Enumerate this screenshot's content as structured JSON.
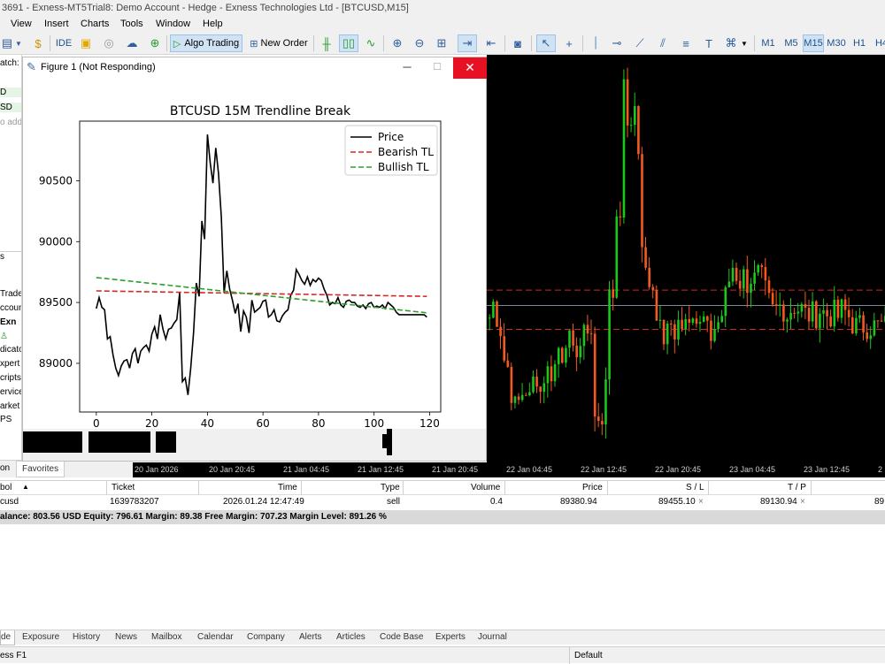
{
  "window": {
    "title": "3691 - Exness-MT5Trial8: Demo Account - Hedge - Exness Technologies Ltd - [BTCUSD,M15]"
  },
  "menu": [
    "View",
    "Insert",
    "Charts",
    "Tools",
    "Window",
    "Help"
  ],
  "toolbar": {
    "ide_label": "IDE",
    "algo_label": "Algo Trading",
    "new_order_label": "New Order",
    "timeframes": [
      "M1",
      "M5",
      "M15",
      "M30",
      "H1",
      "H4"
    ],
    "active_timeframe": "M15"
  },
  "navigator": {
    "watch_label": "atch: 1",
    "items": [
      "D",
      "SD",
      "o add"
    ],
    "tabs": [
      "s",
      "D"
    ],
    "tree": [
      "Trade",
      "ccoun",
      "Exn",
      "dicato",
      "xpert",
      "cripts",
      "ervice",
      "arket",
      "PS"
    ],
    "bottom_tabs": [
      "on",
      "Favorites"
    ]
  },
  "figure": {
    "title": "Figure 1 (Not Responding)",
    "min_glyph": "─",
    "max_glyph": "☐",
    "close_glyph": "✕",
    "chart_data": {
      "type": "line",
      "title": "BTCUSD 15M Trendline Break",
      "xlim": [
        -6,
        124
      ],
      "ylim": [
        88600,
        90990
      ],
      "xticks": [
        0,
        20,
        40,
        60,
        80,
        100,
        120
      ],
      "yticks": [
        89000,
        89500,
        90000,
        90500
      ],
      "legend_position": "upper right",
      "series": [
        {
          "name": "Price",
          "color": "#000000",
          "style": "solid",
          "x": [
            0,
            1,
            2,
            3,
            4,
            5,
            6,
            7,
            8,
            9,
            10,
            11,
            12,
            13,
            14,
            15,
            16,
            17,
            18,
            19,
            20,
            21,
            22,
            23,
            24,
            25,
            26,
            27,
            28,
            29,
            30,
            31,
            32,
            33,
            34,
            35,
            36,
            37,
            38,
            39,
            40,
            41,
            42,
            43,
            44,
            45,
            46,
            47,
            48,
            49,
            50,
            51,
            52,
            53,
            54,
            55,
            56,
            57,
            58,
            59,
            60,
            61,
            62,
            63,
            64,
            65,
            66,
            67,
            68,
            69,
            70,
            71,
            72,
            73,
            74,
            75,
            76,
            77,
            78,
            79,
            80,
            81,
            82,
            83,
            84,
            85,
            86,
            87,
            88,
            89,
            90,
            91,
            92,
            93,
            94,
            95,
            96,
            97,
            98,
            99,
            100,
            101,
            102,
            103,
            104,
            105,
            106,
            107,
            108,
            109,
            110,
            111,
            112,
            113,
            114,
            115,
            116,
            117,
            118,
            119
          ],
          "y": [
            89450,
            89540,
            89460,
            89440,
            89200,
            89220,
            89070,
            88960,
            88900,
            88980,
            89020,
            89030,
            88960,
            89080,
            89120,
            89000,
            89100,
            89130,
            89150,
            89100,
            89240,
            89300,
            89200,
            89400,
            89280,
            89200,
            89280,
            89290,
            89330,
            89360,
            89580,
            88850,
            88880,
            88740,
            88960,
            89250,
            89660,
            89550,
            90170,
            90020,
            90880,
            90650,
            90480,
            90770,
            90560,
            90200,
            89580,
            89760,
            89610,
            89520,
            89410,
            89490,
            89260,
            89430,
            89380,
            89250,
            89520,
            89420,
            89440,
            89460,
            89510,
            89520,
            89380,
            89400,
            89440,
            89350,
            89340,
            89390,
            89420,
            89440,
            89560,
            89600,
            89770,
            89730,
            89680,
            89650,
            89710,
            89640,
            89690,
            89670,
            89700,
            89680,
            89610,
            89560,
            89480,
            89500,
            89490,
            89540,
            89480,
            89460,
            89510,
            89520,
            89500,
            89500,
            89470,
            89460,
            89480,
            89450,
            89490,
            89500,
            89460,
            89470,
            89460,
            89480,
            89450,
            89500,
            89480,
            89460,
            89420,
            89400,
            89400,
            89400,
            89400,
            89400,
            89400,
            89400,
            89400,
            89400,
            89400,
            89380
          ]
        },
        {
          "name": "Bearish TL",
          "color": "#d62728",
          "style": "dashed",
          "x": [
            0,
            119
          ],
          "y": [
            89595,
            89550
          ]
        },
        {
          "name": "Bullish TL",
          "color": "#2ca02c",
          "style": "dashed",
          "x": [
            0,
            119
          ],
          "y": [
            89705,
            89415
          ]
        }
      ]
    }
  },
  "mt_chart": {
    "time_labels": [
      "20 Jan 2026",
      "20 Jan 20:45",
      "21 Jan 04:45",
      "21 Jan 12:45",
      "21 Jan 20:45",
      "22 Jan 04:45",
      "22 Jan 12:45",
      "22 Jan 20:45",
      "23 Jan 04:45",
      "23 Jan 12:45",
      "2"
    ],
    "colors": {
      "bull": "#19c819",
      "bear": "#f45a1e",
      "level": "#cc2a2a"
    },
    "bid_line": 89520,
    "levels": [
      89610,
      89380
    ]
  },
  "terminal": {
    "headers": [
      "bol",
      "Ticket",
      "Time",
      "Type",
      "Volume",
      "Price",
      "S / L",
      "T / P",
      ""
    ],
    "row": {
      "symbol": "cusd",
      "ticket": "1639783207",
      "time": "2026.01.24 12:47:49",
      "type": "sell",
      "volume": "0.4",
      "price": "89380.94",
      "sl": "89455.10",
      "tp": "89130.94",
      "current": "89",
      "x_glyph": "×"
    },
    "balance_line": "alance: 803.56 USD  Equity: 796.61  Margin: 89.38  Free Margin: 707.23  Margin Level: 891.26 %",
    "tabs": [
      "de",
      "Exposure",
      "History",
      "News",
      "Mailbox",
      "Calendar",
      "Company",
      "Alerts",
      "Articles",
      "Code Base",
      "Experts",
      "Journal"
    ]
  },
  "status": {
    "left": "ess F1",
    "profile": "Default"
  }
}
